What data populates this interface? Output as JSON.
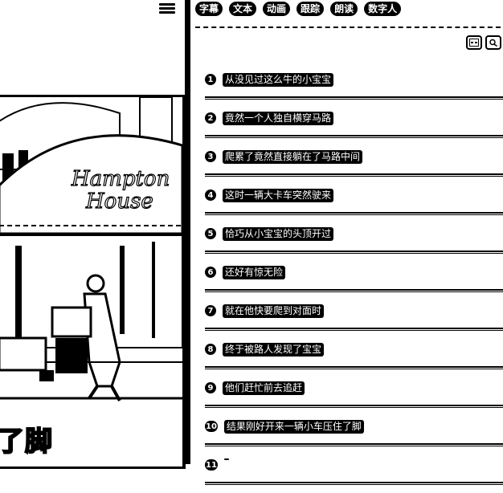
{
  "video": {
    "awning_line1": "Hampton",
    "awning_line2": "House",
    "subtitle": "了脚"
  },
  "tabs": [
    {
      "label": "字幕"
    },
    {
      "label": "文本"
    },
    {
      "label": "动画"
    },
    {
      "label": "跟踪"
    },
    {
      "label": "朗读"
    },
    {
      "label": "数字人"
    }
  ],
  "script_items": [
    {
      "num": "1",
      "text": "从没见过这么牛的小宝宝"
    },
    {
      "num": "2",
      "text": "竟然一个人独自横穿马路"
    },
    {
      "num": "3",
      "text": "爬累了竟然直接躺在了马路中间"
    },
    {
      "num": "4",
      "text": "这时一辆大卡车突然驶来"
    },
    {
      "num": "5",
      "text": "恰巧从小宝宝的头顶开过"
    },
    {
      "num": "6",
      "text": "还好有惊无险"
    },
    {
      "num": "7",
      "text": "就在他快要爬到对面时"
    },
    {
      "num": "8",
      "text": "终于被路人发现了宝宝"
    },
    {
      "num": "9",
      "text": "他们赶忙前去追赶"
    },
    {
      "num": "10",
      "text": "结果刚好开来一辆小车压住了脚"
    },
    {
      "num": "11",
      "text": ""
    }
  ]
}
